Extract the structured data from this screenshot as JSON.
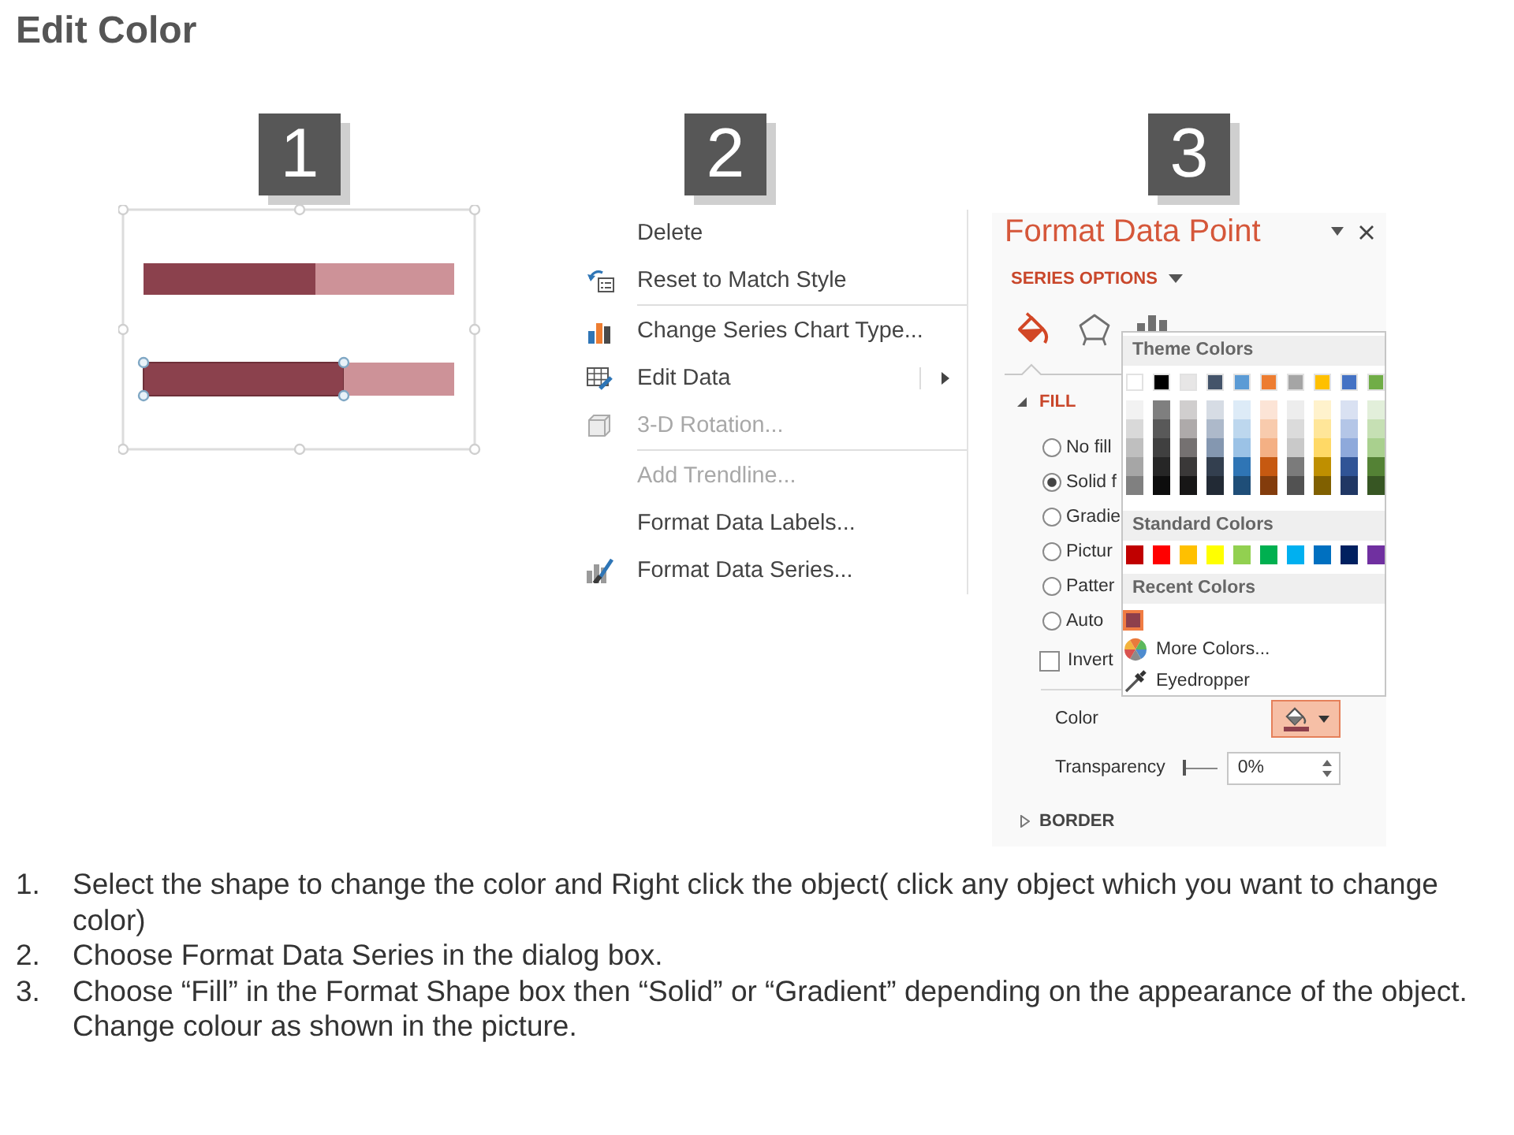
{
  "title": "Edit Color",
  "steps": [
    {
      "number": "1"
    },
    {
      "number": "2"
    },
    {
      "number": "3"
    }
  ],
  "chart_bars": [
    {
      "selected": false
    },
    {
      "selected": true
    }
  ],
  "context_menu": {
    "items": [
      {
        "label": "Delete",
        "disabled": false,
        "submenu": false,
        "separator_after": false
      },
      {
        "label": "Reset to Match Style",
        "disabled": false,
        "submenu": false,
        "separator_after": true
      },
      {
        "label": "Change Series Chart Type...",
        "disabled": false,
        "submenu": false,
        "separator_after": false
      },
      {
        "label": "Edit Data",
        "disabled": false,
        "submenu": true,
        "separator_after": false
      },
      {
        "label": "3-D Rotation...",
        "disabled": true,
        "submenu": false,
        "separator_after": true
      },
      {
        "label": "Add Trendline...",
        "disabled": true,
        "submenu": false,
        "separator_after": false
      },
      {
        "label": "Format Data Labels...",
        "disabled": false,
        "submenu": false,
        "separator_after": false
      },
      {
        "label": "Format Data Series...",
        "disabled": false,
        "submenu": false,
        "separator_after": false
      }
    ]
  },
  "format_pane": {
    "title": "Format Data Point",
    "options_label": "SERIES OPTIONS",
    "option_tabs": [
      {
        "selected": true
      },
      {
        "selected": false
      },
      {
        "selected": false
      }
    ],
    "fill": {
      "label": "FILL",
      "expanded": true,
      "options": [
        {
          "label": "No fill",
          "selected": false
        },
        {
          "label": "Solid f",
          "selected": true
        },
        {
          "label": "Gradie",
          "selected": false
        },
        {
          "label": "Pictur",
          "selected": false
        },
        {
          "label": "Patter",
          "selected": false
        },
        {
          "label": "Auto",
          "selected": false
        }
      ],
      "invert": {
        "label": "Invert",
        "checked": false
      },
      "color": {
        "label": "Color"
      },
      "transparency": {
        "label": "Transparency",
        "level": 0,
        "value": "0%"
      }
    },
    "border": {
      "label": "BORDER",
      "expanded": false
    }
  },
  "color_picker": {
    "theme_label": "Theme Colors",
    "theme_main": [
      {
        "color": "#ffffff",
        "selected": false
      },
      {
        "color": "#000000",
        "selected": false
      },
      {
        "color": "#e7e6e6",
        "selected": false
      },
      {
        "color": "#44546a",
        "selected": false
      },
      {
        "color": "#5b9bd5",
        "selected": false
      },
      {
        "color": "#ed7d31",
        "selected": false
      },
      {
        "color": "#a5a5a5",
        "selected": false
      },
      {
        "color": "#ffc000",
        "selected": false
      },
      {
        "color": "#4472c4",
        "selected": false
      },
      {
        "color": "#70ad47",
        "selected": false
      }
    ],
    "theme_shades": [
      [
        {
          "color": "#f2f2f2",
          "selected": false
        },
        {
          "color": "#7f7f7f",
          "selected": false
        },
        {
          "color": "#d0cece",
          "selected": false
        },
        {
          "color": "#d6dce4",
          "selected": false
        },
        {
          "color": "#ddebf7",
          "selected": false
        },
        {
          "color": "#fce4d6",
          "selected": false
        },
        {
          "color": "#ededed",
          "selected": false
        },
        {
          "color": "#fff2cc",
          "selected": false
        },
        {
          "color": "#d9e1f2",
          "selected": false
        },
        {
          "color": "#e2efda",
          "selected": false
        }
      ],
      [
        {
          "color": "#d9d9d9",
          "selected": false
        },
        {
          "color": "#595959",
          "selected": false
        },
        {
          "color": "#aeaaaa",
          "selected": false
        },
        {
          "color": "#adb9ca",
          "selected": false
        },
        {
          "color": "#bdd7ee",
          "selected": false
        },
        {
          "color": "#f8cbad",
          "selected": false
        },
        {
          "color": "#dbdbdb",
          "selected": false
        },
        {
          "color": "#ffe699",
          "selected": false
        },
        {
          "color": "#b4c6e7",
          "selected": false
        },
        {
          "color": "#c6e0b4",
          "selected": false
        }
      ],
      [
        {
          "color": "#bfbfbf",
          "selected": false
        },
        {
          "color": "#404040",
          "selected": false
        },
        {
          "color": "#757171",
          "selected": false
        },
        {
          "color": "#8497b0",
          "selected": false
        },
        {
          "color": "#9bc2e6",
          "selected": false
        },
        {
          "color": "#f4b084",
          "selected": false
        },
        {
          "color": "#c9c9c9",
          "selected": false
        },
        {
          "color": "#ffd966",
          "selected": false
        },
        {
          "color": "#8ea9db",
          "selected": false
        },
        {
          "color": "#a9d08e",
          "selected": false
        }
      ],
      [
        {
          "color": "#a6a6a6",
          "selected": false
        },
        {
          "color": "#262626",
          "selected": false
        },
        {
          "color": "#3a3838",
          "selected": false
        },
        {
          "color": "#333f4f",
          "selected": false
        },
        {
          "color": "#2f75b5",
          "selected": false
        },
        {
          "color": "#c65911",
          "selected": false
        },
        {
          "color": "#7b7b7b",
          "selected": false
        },
        {
          "color": "#bf8f00",
          "selected": false
        },
        {
          "color": "#305496",
          "selected": false
        },
        {
          "color": "#548235",
          "selected": false
        }
      ],
      [
        {
          "color": "#808080",
          "selected": false
        },
        {
          "color": "#0d0d0d",
          "selected": false
        },
        {
          "color": "#171616",
          "selected": false
        },
        {
          "color": "#222a35",
          "selected": false
        },
        {
          "color": "#1f4e78",
          "selected": false
        },
        {
          "color": "#833c0c",
          "selected": false
        },
        {
          "color": "#525252",
          "selected": false
        },
        {
          "color": "#806000",
          "selected": false
        },
        {
          "color": "#203764",
          "selected": false
        },
        {
          "color": "#375623",
          "selected": false
        }
      ]
    ],
    "standard_label": "Standard Colors",
    "standard": [
      {
        "color": "#c00000",
        "selected": false
      },
      {
        "color": "#ff0000",
        "selected": false
      },
      {
        "color": "#ffc000",
        "selected": false
      },
      {
        "color": "#ffff00",
        "selected": false
      },
      {
        "color": "#92d050",
        "selected": false
      },
      {
        "color": "#00b050",
        "selected": false
      },
      {
        "color": "#00b0f0",
        "selected": false
      },
      {
        "color": "#0070c0",
        "selected": false
      },
      {
        "color": "#002060",
        "selected": false
      },
      {
        "color": "#7030a0",
        "selected": false
      }
    ],
    "recent_label": "Recent Colors",
    "recent": [
      {
        "color": "#8e3f4c",
        "selected": true
      }
    ],
    "actions": [
      {
        "label": "More Colors..."
      },
      {
        "label": "Eyedropper"
      }
    ]
  },
  "instructions": [
    {
      "number": "1.",
      "text": "Select the shape to change the color and Right click the object( click any object which you want to change color)"
    },
    {
      "number": "2.",
      "text": "Choose Format Data Series in the dialog box."
    },
    {
      "number": "3.",
      "text": "Choose “Fill” in the Format Shape box then “Solid” or “Gradient” depending on the appearance of the object. Change colour as shown in the picture."
    }
  ]
}
